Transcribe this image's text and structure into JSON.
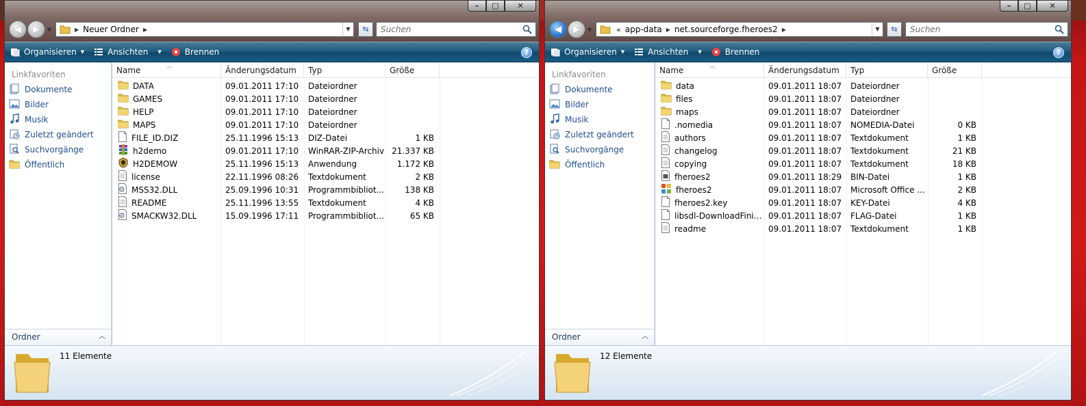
{
  "left": {
    "crumbs": [
      "Neuer Ordner"
    ],
    "search_placeholder": "Suchen",
    "toolbar": {
      "organize": "Organisieren",
      "views": "Ansichten",
      "burn": "Brennen"
    },
    "favorites_title": "Linkfavoriten",
    "favorites": [
      {
        "label": "Dokumente",
        "icon": "documents-icon"
      },
      {
        "label": "Bilder",
        "icon": "pictures-icon"
      },
      {
        "label": "Musik",
        "icon": "music-icon"
      },
      {
        "label": "Zuletzt geändert",
        "icon": "recent-icon"
      },
      {
        "label": "Suchvorgänge",
        "icon": "searches-icon"
      },
      {
        "label": "Öffentlich",
        "icon": "public-folder-icon"
      }
    ],
    "folders_label": "Ordner",
    "columns": [
      "Name",
      "Änderungsdatum",
      "Typ",
      "Größe"
    ],
    "files": [
      {
        "name": "DATA",
        "date": "09.01.2011 17:10",
        "type": "Dateiordner",
        "size": "",
        "icon": "folder"
      },
      {
        "name": "GAMES",
        "date": "09.01.2011 17:10",
        "type": "Dateiordner",
        "size": "",
        "icon": "folder"
      },
      {
        "name": "HELP",
        "date": "09.01.2011 17:10",
        "type": "Dateiordner",
        "size": "",
        "icon": "folder"
      },
      {
        "name": "MAPS",
        "date": "09.01.2011 17:10",
        "type": "Dateiordner",
        "size": "",
        "icon": "folder"
      },
      {
        "name": "FILE_ID.DIZ",
        "date": "25.11.1996 15:13",
        "type": "DIZ-Datei",
        "size": "1 KB",
        "icon": "file"
      },
      {
        "name": "h2demo",
        "date": "09.01.2011 17:10",
        "type": "WinRAR-ZIP-Archiv",
        "size": "21.337 KB",
        "icon": "winrar"
      },
      {
        "name": "H2DEMOW",
        "date": "25.11.1996 15:13",
        "type": "Anwendung",
        "size": "1.172 KB",
        "icon": "app"
      },
      {
        "name": "license",
        "date": "22.11.1996 08:26",
        "type": "Textdokument",
        "size": "2 KB",
        "icon": "text"
      },
      {
        "name": "MSS32.DLL",
        "date": "25.09.1996 10:31",
        "type": "Programmbibliot...",
        "size": "138 KB",
        "icon": "dll"
      },
      {
        "name": "README",
        "date": "25.11.1996 13:55",
        "type": "Textdokument",
        "size": "4 KB",
        "icon": "text"
      },
      {
        "name": "SMACKW32.DLL",
        "date": "15.09.1996 17:11",
        "type": "Programmbibliot...",
        "size": "65 KB",
        "icon": "dll"
      }
    ],
    "count": "11 Elemente"
  },
  "right": {
    "crumbs": [
      "app-data",
      "net.sourceforge.fheroes2"
    ],
    "crumb_overflow": "«",
    "search_placeholder": "Suchen",
    "toolbar": {
      "organize": "Organisieren",
      "views": "Ansichten",
      "burn": "Brennen"
    },
    "favorites_title": "Linkfavoriten",
    "favorites": [
      {
        "label": "Dokumente",
        "icon": "documents-icon"
      },
      {
        "label": "Bilder",
        "icon": "pictures-icon"
      },
      {
        "label": "Musik",
        "icon": "music-icon"
      },
      {
        "label": "Zuletzt geändert",
        "icon": "recent-icon"
      },
      {
        "label": "Suchvorgänge",
        "icon": "searches-icon"
      },
      {
        "label": "Öffentlich",
        "icon": "public-folder-icon"
      }
    ],
    "folders_label": "Ordner",
    "columns": [
      "Name",
      "Änderungsdatum",
      "Typ",
      "Größe"
    ],
    "files": [
      {
        "name": "data",
        "date": "09.01.2011 18:07",
        "type": "Dateiordner",
        "size": "",
        "icon": "folder"
      },
      {
        "name": "files",
        "date": "09.01.2011 18:07",
        "type": "Dateiordner",
        "size": "",
        "icon": "folder"
      },
      {
        "name": "maps",
        "date": "09.01.2011 18:07",
        "type": "Dateiordner",
        "size": "",
        "icon": "folder"
      },
      {
        "name": ".nomedia",
        "date": "09.01.2011 18:07",
        "type": "NOMEDIA-Datei",
        "size": "0 KB",
        "icon": "file"
      },
      {
        "name": "authors",
        "date": "09.01.2011 18:07",
        "type": "Textdokument",
        "size": "1 KB",
        "icon": "text"
      },
      {
        "name": "changelog",
        "date": "09.01.2011 18:07",
        "type": "Textdokument",
        "size": "21 KB",
        "icon": "text"
      },
      {
        "name": "copying",
        "date": "09.01.2011 18:07",
        "type": "Textdokument",
        "size": "18 KB",
        "icon": "text"
      },
      {
        "name": "fheroes2",
        "date": "09.01.2011 18:29",
        "type": "BIN-Datei",
        "size": "1 KB",
        "icon": "bin"
      },
      {
        "name": "fheroes2",
        "date": "09.01.2011 18:07",
        "type": "Microsoft Office ...",
        "size": "2 KB",
        "icon": "office"
      },
      {
        "name": "fheroes2.key",
        "date": "09.01.2011 18:07",
        "type": "KEY-Datei",
        "size": "4 KB",
        "icon": "file"
      },
      {
        "name": "libsdl-DownloadFinish...",
        "date": "09.01.2011 18:07",
        "type": "FLAG-Datei",
        "size": "1 KB",
        "icon": "file"
      },
      {
        "name": "readme",
        "date": "09.01.2011 18:07",
        "type": "Textdokument",
        "size": "1 KB",
        "icon": "text"
      }
    ],
    "count": "12 Elemente"
  },
  "colors": {
    "toolbar": "#1a5a80",
    "link": "#1e4d8c",
    "folder": "#e8c24a"
  }
}
